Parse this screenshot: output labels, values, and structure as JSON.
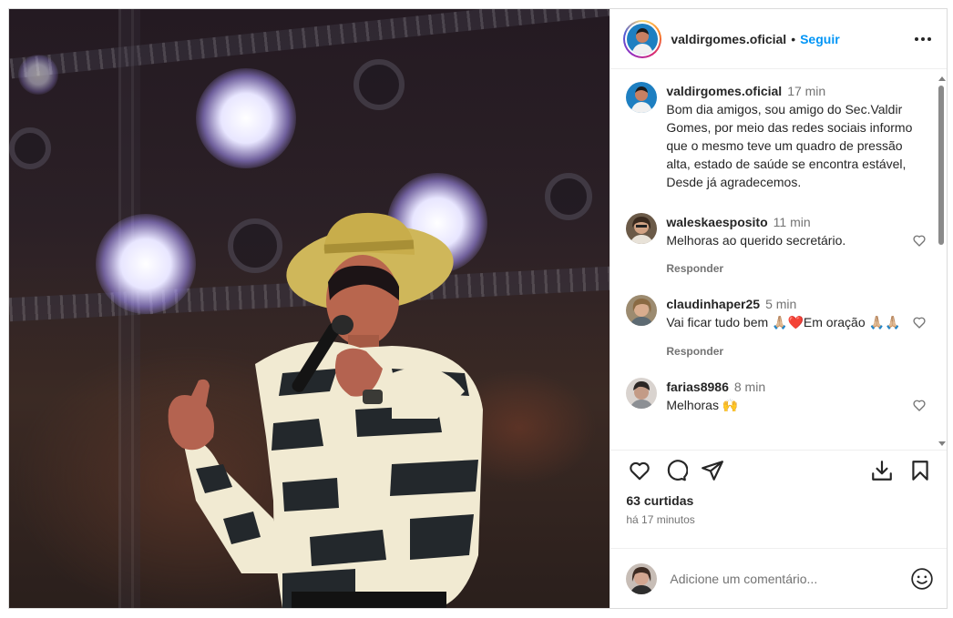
{
  "post": {
    "author": "valdirgomes.oficial",
    "follow_label": "Seguir",
    "separator": "•",
    "caption": {
      "username": "valdirgomes.oficial",
      "time": "17 min",
      "text": "Bom dia amigos, sou amigo do Sec.Valdir Gomes, por meio das redes sociais informo que o mesmo teve um quadro de  pressão alta, estado de saúde se encontra estável, Desde já agradecemos."
    },
    "comments": [
      {
        "username": "waleskaesposito",
        "time": "11 min",
        "text": "Melhoras ao querido secretário.",
        "reply": "Responder"
      },
      {
        "username": "claudinhaper25",
        "time": "5 min",
        "text_a": "Vai ficar tudo bem ",
        "emoji_a": "🙏🏼❤️",
        "text_b": "Em oração",
        "emoji_b": "🙏🏼🙏🏼",
        "reply": "Responder"
      },
      {
        "username": "farias8986",
        "time": "8 min",
        "text": "Melhoras ",
        "emoji": "🙌"
      }
    ],
    "likes": "63 curtidas",
    "posted_ago": "há 17 minutos",
    "add_comment_placeholder": "Adicione um comentário..."
  },
  "icons": {
    "more": "more-options-icon",
    "like": "heart-icon",
    "comment": "comment-icon",
    "share": "share-icon",
    "save": "bookmark-icon",
    "download": "download-icon",
    "emoji": "smiley-icon"
  },
  "colors": {
    "accent": "#0095f6",
    "text": "#262626",
    "muted": "#737373"
  }
}
